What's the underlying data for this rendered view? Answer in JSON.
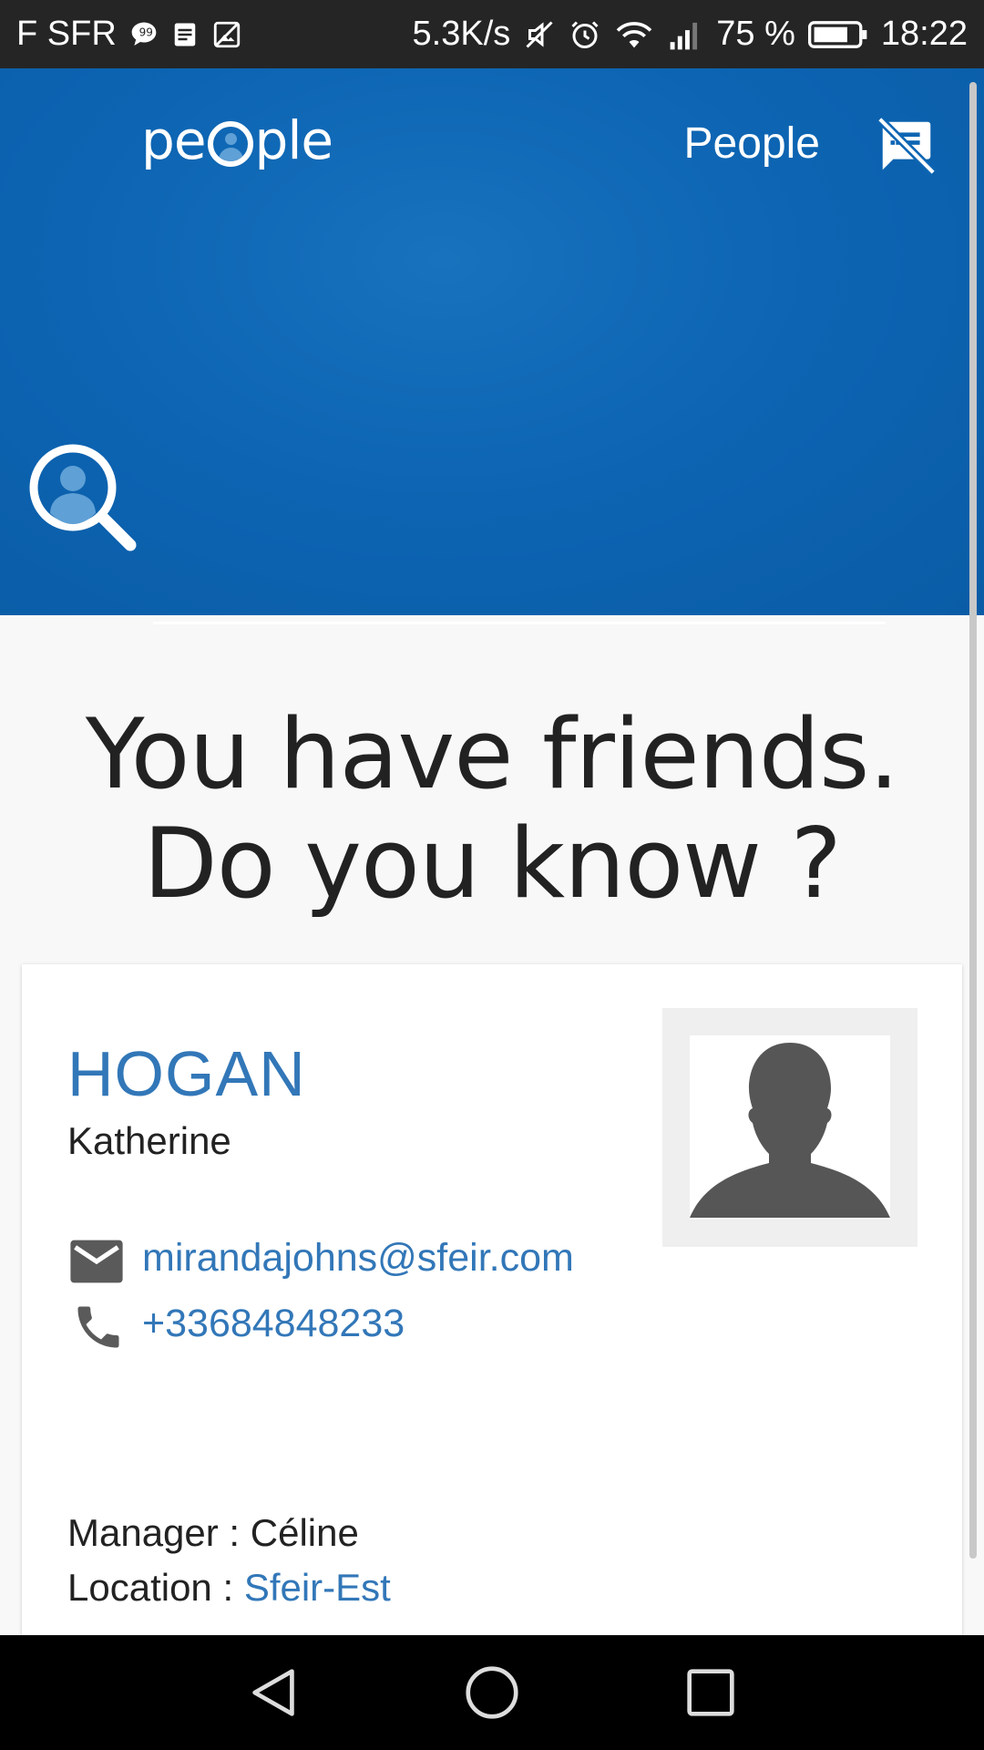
{
  "status_bar": {
    "carrier": "F SFR",
    "speed": "5.3K/s",
    "battery": "75 %",
    "time": "18:22",
    "icons": [
      "chat-bubble-icon",
      "notes-icon",
      "image-icon",
      "mute-icon",
      "alarm-icon",
      "wifi-icon",
      "signal-icon",
      "battery-icon"
    ]
  },
  "header": {
    "logo": {
      "left": "pe",
      "right": "ple"
    },
    "title": "People",
    "chat_icon": "speaker-notes-off-icon",
    "search_icon": "person-search-icon",
    "search": {
      "value": "",
      "placeholder": ""
    }
  },
  "headline": {
    "line1": "You have friends.",
    "line2": "Do you know ?"
  },
  "card": {
    "last_name": "HOGAN",
    "first_name": "Katherine",
    "email": "mirandajohns@sfeir.com",
    "phone": "+33684848233",
    "manager_label": "Manager : ",
    "manager": "Céline",
    "location_label": "Location : ",
    "location": "Sfeir-Est",
    "photo_icon": "avatar-placeholder-icon"
  },
  "nav": {
    "icons": [
      "back-icon",
      "home-icon",
      "recents-icon"
    ]
  },
  "colors": {
    "header_blue": "#0d65b3",
    "link_blue": "#3277b8",
    "text": "#222222"
  }
}
